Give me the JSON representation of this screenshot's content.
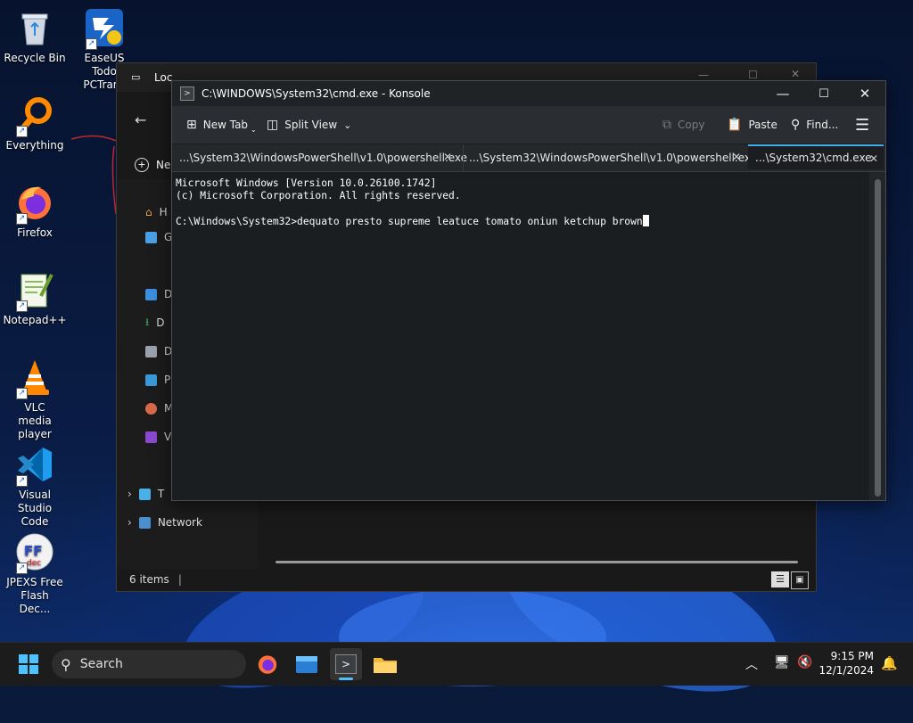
{
  "desktop": {
    "icons": [
      {
        "label": "Recycle Bin",
        "icon": "recycle-bin-icon"
      },
      {
        "label": "EaseUS Todo PCTrans",
        "icon": "easeus-icon"
      },
      {
        "label": "Everything",
        "icon": "everything-search-icon"
      },
      {
        "label": "Firefox",
        "icon": "firefox-icon"
      },
      {
        "label": "Notepad++",
        "icon": "notepad-plus-plus-icon"
      },
      {
        "label": "VLC media player",
        "icon": "vlc-icon"
      },
      {
        "label": "Visual Studio Code",
        "icon": "vscode-icon"
      },
      {
        "label": "JPEXS Free Flash Dec...",
        "icon": "jpexs-icon"
      }
    ]
  },
  "explorer": {
    "title": "Loc",
    "new_label": "Ne",
    "nav_items": [
      "H",
      "G",
      "D",
      "D",
      "D",
      "P",
      "M",
      "V",
      "T"
    ],
    "network_label": "Network",
    "status": "6 items"
  },
  "konsole": {
    "title": "C:\\WINDOWS\\System32\\cmd.exe - Konsole",
    "toolbar": {
      "new_tab": "New Tab",
      "split_view": "Split View",
      "copy": "Copy",
      "paste": "Paste",
      "find": "Find..."
    },
    "tabs": [
      {
        "label": "...\\System32\\WindowsPowerShell\\v1.0\\powershell.exe",
        "active": false
      },
      {
        "label": "...\\System32\\WindowsPowerShell\\v1.0\\powershell.exe",
        "active": false
      },
      {
        "label": "...\\System32\\cmd.exe",
        "active": true
      }
    ],
    "terminal": {
      "line1": "Microsoft Windows [Version 10.0.26100.1742]",
      "line2": "(c) Microsoft Corporation. All rights reserved.",
      "line3": "",
      "prompt": "C:\\Windows\\System32>",
      "command": "dequato presto supreme leatuce tomato oniun ketchup brown"
    }
  },
  "taskbar": {
    "search_placeholder": "Search",
    "time": "9:15 PM",
    "date": "12/1/2024"
  },
  "colors": {
    "accent": "#3daee9",
    "terminal_bg": "#1b1e20",
    "taskbar_bg": "#1c1c1c"
  }
}
